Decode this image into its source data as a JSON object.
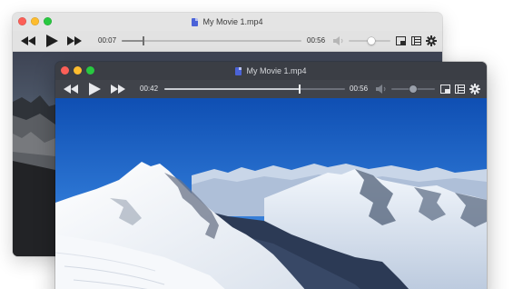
{
  "back_window": {
    "title": "My Movie 1.mp4",
    "current_time": "00:07",
    "total_time": "00:56",
    "progress": 0.12,
    "volume": 0.55
  },
  "front_window": {
    "title": "My Movie 1.mp4",
    "current_time": "00:42",
    "total_time": "00:56",
    "progress": 0.75,
    "volume": 0.5
  },
  "icons": {
    "rewind": "rewind-icon",
    "play": "play-icon",
    "fast_forward": "fast-forward-icon",
    "volume": "speaker-icon",
    "picture_in_picture": "pip-icon",
    "playlist": "playlist-icon",
    "settings": "gear-icon",
    "file": "video-file-icon"
  },
  "colors": {
    "close": "#fc5f57",
    "minimize": "#fdbc2e",
    "zoom": "#28c840",
    "file_icon": "#4b63d8"
  }
}
